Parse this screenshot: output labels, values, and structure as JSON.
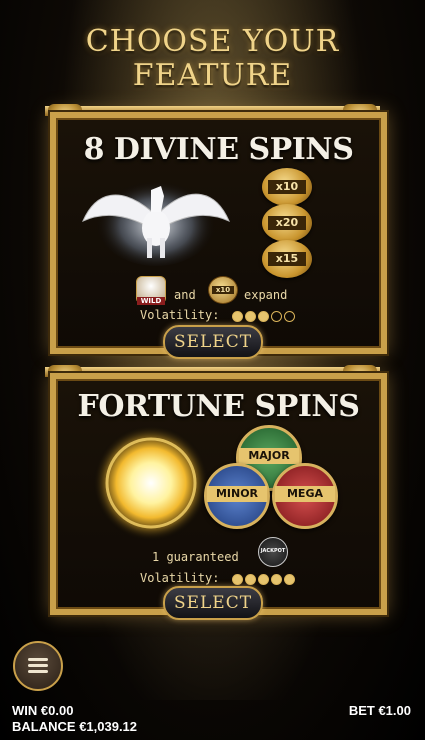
{
  "header": {
    "line1": "CHOOSE YOUR",
    "line2": "FEATURE"
  },
  "feature1": {
    "title": "8 DIVINE SPINS",
    "multipliers": [
      "x10",
      "x20",
      "x15"
    ],
    "wild_label": "WILD",
    "coin_small": "x10",
    "and_text": "and",
    "expand_text": "expand",
    "volatility_label": "Volatility:",
    "volatility_level": 3,
    "volatility_max": 5,
    "select_label": "SELECT"
  },
  "feature2": {
    "title": "FORTUNE SPINS",
    "jackpots": [
      "MAJOR",
      "MINOR",
      "MEGA"
    ],
    "guaranteed_text": "1 guaranteed",
    "jackpot_badge": "JACKPOT",
    "volatility_label": "Volatility:",
    "volatility_level": 5,
    "volatility_max": 5,
    "select_label": "SELECT"
  },
  "footer": {
    "win_label": "WIN",
    "win_value": "€0.00",
    "balance_label": "BALANCE",
    "balance_value": "€1,039.12",
    "bet_label": "BET",
    "bet_value": "€1.00"
  },
  "colors": {
    "gold": "#c9a04a",
    "major": "#2f7a3a",
    "minor": "#2a4f9a",
    "mega": "#a8262a"
  },
  "icons": [
    "pegasus-image",
    "sun-orb-image",
    "menu-icon"
  ]
}
